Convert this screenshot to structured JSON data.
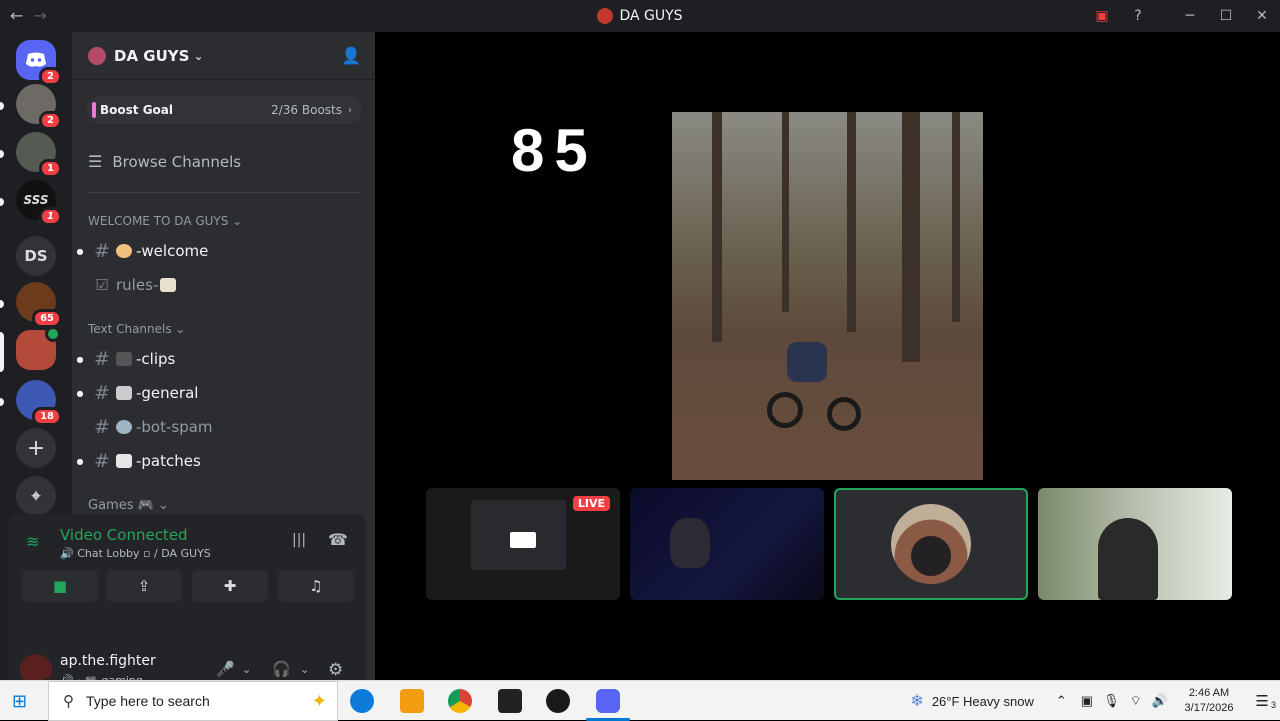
{
  "window": {
    "title": "DA GUYS",
    "nav_back": "←",
    "nav_fwd": "→"
  },
  "guilds": [
    {
      "label": "",
      "badge": "2"
    },
    {
      "label": "",
      "badge": "2"
    },
    {
      "label": "",
      "badge": "1"
    },
    {
      "label": "SSS",
      "badge": "1"
    },
    {
      "label": "DS",
      "badge": ""
    },
    {
      "label": "",
      "badge": "65"
    },
    {
      "label": "",
      "badge": ""
    },
    {
      "label": "",
      "badge": "18"
    }
  ],
  "server": {
    "name": "DA GUYS",
    "boost_label": "Boost Goal",
    "boost_count": "2/36 Boosts",
    "browse": "Browse Channels",
    "categories": [
      "WELCOME TO DA GUYS",
      "Text Channels",
      "Games"
    ],
    "channels": [
      {
        "name": "-welcome",
        "emoji": "wave"
      },
      {
        "name": "rules-",
        "emoji": "clipboard"
      },
      {
        "name": "-clips",
        "emoji": "camera"
      },
      {
        "name": "-general",
        "emoji": "speech"
      },
      {
        "name": "-bot-spam",
        "emoji": "robot"
      },
      {
        "name": "-patches",
        "emoji": "page"
      }
    ]
  },
  "voice": {
    "status": "Video Connected",
    "location": "Chat Lobby",
    "server": "/ DA GUYS"
  },
  "user": {
    "name": "ap.the.fighter",
    "status": "gaming"
  },
  "stage": {
    "counter": "85",
    "live": "LIVE"
  },
  "taskbar": {
    "search_placeholder": "Type here to search",
    "weather": "26°F  Heavy snow",
    "time": "2:46 AM",
    "date": "3/17/2026",
    "notif_count": "3"
  },
  "colors": {
    "accent_green": "#23a55a",
    "badge_red": "#f23f43",
    "sidebar_bg": "#2b2d31"
  }
}
